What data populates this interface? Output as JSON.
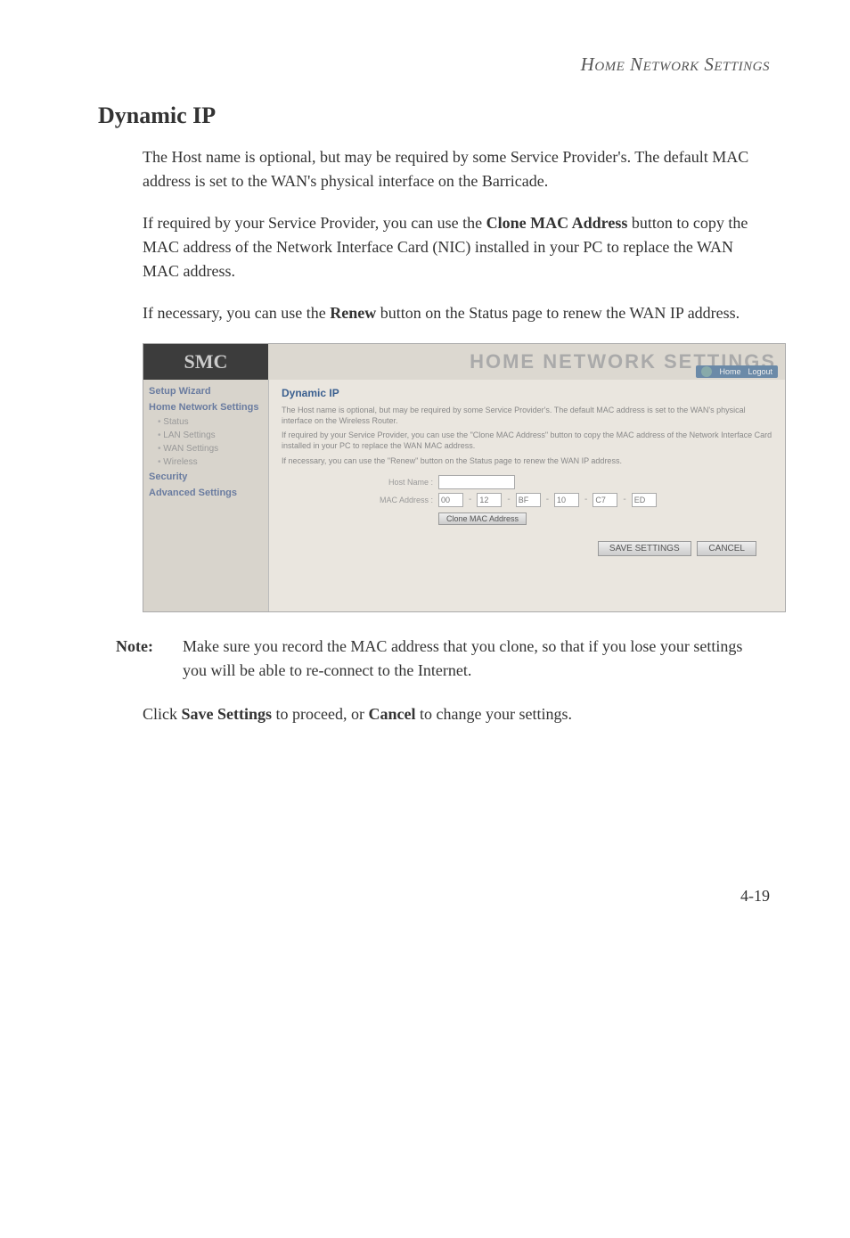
{
  "header": {
    "section_label": "Home Network Settings"
  },
  "heading": "Dynamic IP",
  "para1": "The Host name is optional, but may be required by some Service Provider's. The default MAC address is set to the WAN's physical interface on the Barricade.",
  "para2_pre": "If required by your Service Provider, you can use the ",
  "para2_bold": "Clone MAC Address",
  "para2_post": " button to copy the MAC address of the Network Interface Card (NIC) installed in your PC to replace the WAN MAC address.",
  "para3_pre": "If necessary, you can use the ",
  "para3_bold": "Renew",
  "para3_post": " button on the Status page to renew the WAN IP address.",
  "screenshot": {
    "logo": "SMC",
    "title": "HOME NETWORK SETTINGS",
    "toplinks": {
      "home": "Home",
      "logout": "Logout"
    },
    "sidebar": {
      "setup_wizard": "Setup Wizard",
      "home_network_settings": "Home Network Settings",
      "status": "Status",
      "lan_settings": "LAN Settings",
      "wan_settings": "WAN Settings",
      "wireless": "Wireless",
      "security": "Security",
      "advanced_settings": "Advanced Settings"
    },
    "content": {
      "title": "Dynamic IP",
      "desc1": "The Host name is optional, but may be required by some Service Provider's. The default MAC address is set to the WAN's physical interface on the Wireless Router.",
      "desc2": "If required by your Service Provider, you can use the \"Clone MAC Address\" button to copy the MAC address of the Network Interface Card installed in your PC to replace the WAN MAC address.",
      "desc3": "If necessary, you can use the \"Renew\" button on the Status page to renew the WAN IP address.",
      "host_name_label": "Host Name :",
      "host_name_value": "",
      "mac_label": "MAC Address :",
      "mac": {
        "m1": "00",
        "m2": "12",
        "m3": "BF",
        "m4": "10",
        "m5": "C7",
        "m6": "ED"
      },
      "sep": "-",
      "clone_btn": "Clone MAC Address",
      "save_btn": "SAVE SETTINGS",
      "cancel_btn": "CANCEL"
    }
  },
  "note": {
    "label": "Note:",
    "text": "Make sure you record the MAC address that you clone, so that if you lose your settings you will be able to re-connect to the Internet."
  },
  "final_para_pre": "Click ",
  "final_para_b1": "Save Settings",
  "final_para_mid": " to proceed, or ",
  "final_para_b2": "Cancel",
  "final_para_post": " to change your settings.",
  "page_number": "4-19"
}
